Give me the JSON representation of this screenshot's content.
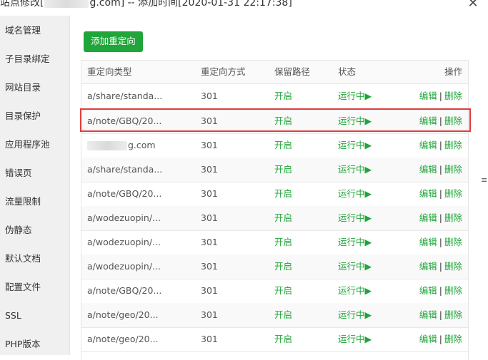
{
  "window": {
    "title_prefix": "站点修改[",
    "title_suffix": "g.com] -- 添加时间[2020-01-31 22:17:38]",
    "close_symbol": "✕"
  },
  "sidebar": {
    "items": [
      {
        "label": "域名管理"
      },
      {
        "label": "子目录绑定"
      },
      {
        "label": "网站目录"
      },
      {
        "label": "目录保护"
      },
      {
        "label": "应用程序池"
      },
      {
        "label": "错误页"
      },
      {
        "label": "流量限制"
      },
      {
        "label": "伪静态"
      },
      {
        "label": "默认文档"
      },
      {
        "label": "配置文件"
      },
      {
        "label": "SSL"
      },
      {
        "label": "PHP版本"
      }
    ]
  },
  "toolbar": {
    "add_label": "添加重定向"
  },
  "table": {
    "headers": {
      "type": "重定向类型",
      "method": "重定向方式",
      "keep_path": "保留路径",
      "status": "状态",
      "ops": "操作"
    },
    "rows": [
      {
        "type": "a/share/standa...",
        "method": "301",
        "keep_path": "开启",
        "status": "运行中▶",
        "edit": "编辑",
        "sep": "|",
        "delete": "删除"
      },
      {
        "type": "a/note/GBQ/20...",
        "method": "301",
        "keep_path": "开启",
        "status": "运行中▶",
        "edit": "编辑",
        "sep": "|",
        "delete": "删除"
      },
      {
        "type": "g.com",
        "method": "301",
        "keep_path": "开启",
        "status": "运行中▶",
        "edit": "编辑",
        "sep": "|",
        "delete": "删除"
      },
      {
        "type": "a/share/standa...",
        "method": "301",
        "keep_path": "开启",
        "status": "运行中▶",
        "edit": "编辑",
        "sep": "|",
        "delete": "删除"
      },
      {
        "type": "a/note/GBQ/20...",
        "method": "301",
        "keep_path": "开启",
        "status": "运行中▶",
        "edit": "编辑",
        "sep": "|",
        "delete": "删除"
      },
      {
        "type": "a/wodezuopin/...",
        "method": "301",
        "keep_path": "开启",
        "status": "运行中▶",
        "edit": "编辑",
        "sep": "|",
        "delete": "删除"
      },
      {
        "type": "a/wodezuopin/...",
        "method": "301",
        "keep_path": "开启",
        "status": "运行中▶",
        "edit": "编辑",
        "sep": "|",
        "delete": "删除"
      },
      {
        "type": "a/wodezuopin/...",
        "method": "301",
        "keep_path": "开启",
        "status": "运行中▶",
        "edit": "编辑",
        "sep": "|",
        "delete": "删除"
      },
      {
        "type": "a/note/GBQ/20...",
        "method": "301",
        "keep_path": "开启",
        "status": "运行中▶",
        "edit": "编辑",
        "sep": "|",
        "delete": "删除"
      },
      {
        "type": "a/note/geo/20...",
        "method": "301",
        "keep_path": "开启",
        "status": "运行中▶",
        "edit": "编辑",
        "sep": "|",
        "delete": "删除"
      },
      {
        "type": "a/note/geo/20...",
        "method": "301",
        "keep_path": "开启",
        "status": "运行中▶",
        "edit": "编辑",
        "sep": "|",
        "delete": "删除"
      }
    ]
  },
  "scrollbar": {
    "grip_symbol": "≡"
  },
  "colors": {
    "accent_green": "#20a53a",
    "highlight_red": "#e23b3b",
    "sidebar_bg": "#f0f0f0"
  }
}
